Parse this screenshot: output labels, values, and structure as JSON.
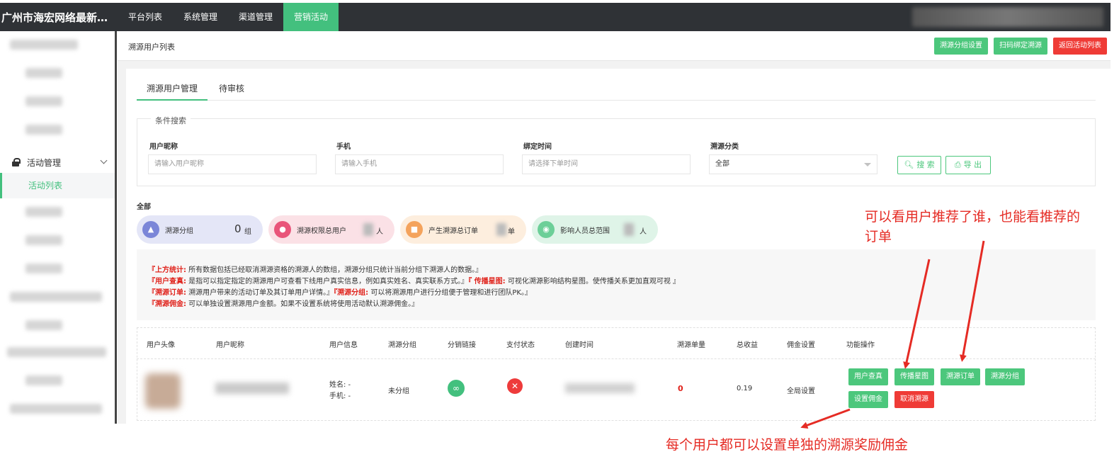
{
  "topbar": {
    "brand": "广州市海宏网络最新红...",
    "nav": [
      "平台列表",
      "系统管理",
      "渠道管理",
      "营销活动"
    ],
    "active_index": 3
  },
  "sidebar": {
    "group_label": "活动管理",
    "active_item": "活动列表"
  },
  "header": {
    "page_title": "溯源用户列表",
    "buttons": {
      "group_settings": "溯源分组设置",
      "scan_bind": "扫码绑定溯源",
      "back": "返回活动列表"
    }
  },
  "tabs": [
    "溯源用户管理",
    "待审核"
  ],
  "search": {
    "legend": "条件搜索",
    "fields": {
      "nickname": {
        "label": "用户昵称",
        "placeholder": "请输入用户昵称"
      },
      "phone": {
        "label": "手机",
        "placeholder": "请输入手机"
      },
      "bind_time": {
        "label": "绑定时间",
        "placeholder": "请选择下单时间"
      },
      "category": {
        "label": "溯源分类",
        "value": "全部"
      }
    },
    "search_button": "搜 索",
    "export_button": "导 出"
  },
  "stats": {
    "all_label": "全部",
    "groups": {
      "label": "溯源分组",
      "value": "0",
      "unit": "组"
    },
    "users": {
      "label": "溯源权限总用户",
      "unit": "人"
    },
    "orders": {
      "label": "产生溯源总订单",
      "unit": "单"
    },
    "reach": {
      "label": "影响人员总范围",
      "unit": "人"
    }
  },
  "notes": {
    "line1": {
      "key": "『上方统计:",
      "text": " 所有数据包括已经取消溯源资格的溯源人的数组，溯源分组只统计当前分组下溯源人的数据。』"
    },
    "line2a": {
      "key": "『用户查真:",
      "text": " 是指可以指定指定的溯源用户可查看下线用户真实信息，例如真实姓名、真实联系方式。』"
    },
    "line2b": {
      "key": "『 传播星图:",
      "text": " 可视化溯源影响结构星图。使传播关系更加直观可视 』"
    },
    "line3a": {
      "key": "『溯源订单:",
      "text": " 溯源用户带来的活动订单及其订单用户详情。』"
    },
    "line3b": {
      "key": "『溯源分组:",
      "text": " 可以将溯源用户进行分组便于管理和进行团队PK。』"
    },
    "line4": {
      "key": "『溯源佣金:",
      "text": " 可以单独设置溯源用户金额。如果不设置系统将使用活动默认溯源佣金。』"
    }
  },
  "table": {
    "headers": [
      "用户头像",
      "用户昵称",
      "用户信息",
      "溯源分组",
      "分销链接",
      "支付状态",
      "创建时间",
      "溯源单量",
      "总收益",
      "佣金设置",
      "功能操作"
    ],
    "row": {
      "name_label": "姓名: -",
      "phone_label": "手机: -",
      "group": "未分组",
      "order_count": "0",
      "revenue": "0.19",
      "commission": "全局设置",
      "actions": [
        "用户查真",
        "传播星图",
        "溯源订单",
        "溯源分组",
        "设置佣金",
        "取消溯源"
      ]
    }
  },
  "annotations": {
    "top_line1": "可以看用户推荐了谁，也能看推荐的",
    "top_line2": "订单",
    "bottom": "每个用户都可以设置单独的溯源奖励佣金"
  },
  "colors": {
    "accent": "#43c07e",
    "danger": "#ef3b36",
    "annotation": "#e52b24",
    "topbar": "#2f3236"
  }
}
